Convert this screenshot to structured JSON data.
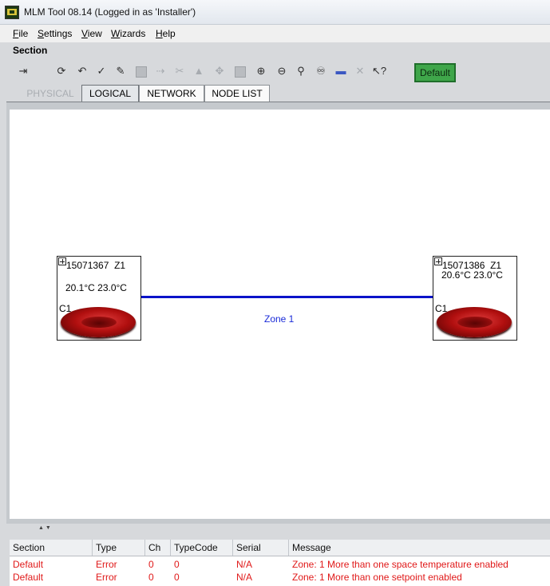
{
  "window": {
    "title": "MLM Tool 08.14  (Logged in as 'Installer')"
  },
  "menu": [
    "File",
    "Settings",
    "View",
    "Wizards",
    "Help"
  ],
  "section": {
    "title": "Section"
  },
  "toolbar": {
    "icons": [
      "exit-icon",
      "refresh-icon",
      "undo-icon",
      "check-icon",
      "edit-icon",
      "grid-icon",
      "move-icon",
      "cut-icon",
      "up-icon",
      "center-icon",
      "block-icon",
      "zoom-in-icon",
      "zoom-out-icon",
      "zoom-fit-icon",
      "find-icon",
      "line-icon",
      "disabled-icon",
      "help-cursor-icon"
    ],
    "default_label": "Default",
    "default_color": "#3fa64a"
  },
  "tabs": [
    {
      "label": "PHYSICAL",
      "state": "disabled"
    },
    {
      "label": "LOGICAL",
      "state": "active"
    },
    {
      "label": "NETWORK",
      "state": "normal"
    },
    {
      "label": "NODE LIST",
      "state": "normal"
    }
  ],
  "diagram": {
    "nodes": [
      {
        "id": "15071367",
        "zone": "Z1",
        "temps": "20.1°C 23.0°C",
        "channel": "C1"
      },
      {
        "id": "15071386",
        "zone": "Z1",
        "temps": "20.6°C 23.0°C",
        "channel": "C1"
      }
    ],
    "link_label": "Zone 1",
    "link_color": "#0b13c9"
  },
  "messages": {
    "columns": [
      "Section",
      "Type",
      "Ch",
      "TypeCode",
      "Serial",
      "Message"
    ],
    "rows": [
      [
        "Default",
        "Error",
        "0",
        "0",
        "N/A",
        "Zone: 1 More than one space temperature enabled"
      ],
      [
        "Default",
        "Error",
        "0",
        "0",
        "N/A",
        "Zone: 1 More than one setpoint enabled"
      ]
    ],
    "error_color": "#e01919"
  }
}
